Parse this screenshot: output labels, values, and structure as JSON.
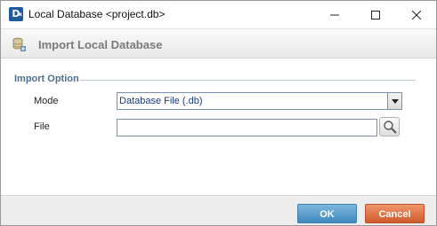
{
  "window": {
    "title": "Local Database <project.db>",
    "app_icon_letter": "D",
    "app_icon_sub": "x"
  },
  "header": {
    "title": "Import Local Database",
    "icon": "database-import-icon"
  },
  "import_option": {
    "group_title": "Import Option",
    "mode_label": "Mode",
    "mode_value": "Database File (.db)",
    "file_label": "File",
    "file_value": "",
    "file_placeholder": ""
  },
  "footer": {
    "ok_label": "OK",
    "cancel_label": "Cancel"
  },
  "colors": {
    "group_title": "#4d6f93",
    "ok_button": "#4a90c6",
    "cancel_button": "#d9693a",
    "app_icon": "#1e5a9c"
  }
}
